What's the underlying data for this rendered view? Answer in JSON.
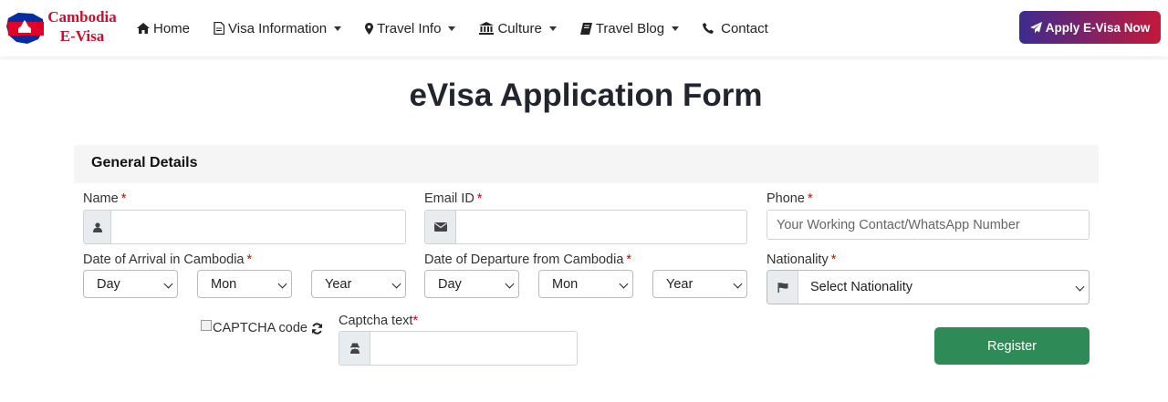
{
  "brand": {
    "line1": "Cambodia",
    "line2": "E-Visa"
  },
  "nav": {
    "items": [
      {
        "label": "Home",
        "icon": "home-icon",
        "dropdown": false
      },
      {
        "label": "Visa Information",
        "icon": "document-icon",
        "dropdown": true
      },
      {
        "label": "Travel Info",
        "icon": "map-marker-icon",
        "dropdown": true
      },
      {
        "label": "Culture",
        "icon": "bank-icon",
        "dropdown": true
      },
      {
        "label": "Travel Blog",
        "icon": "book-icon",
        "dropdown": true
      },
      {
        "label": "Contact",
        "icon": "phone-icon",
        "dropdown": false
      }
    ],
    "apply_label": "Apply E-Visa Now"
  },
  "page": {
    "title": "eVisa Application Form"
  },
  "form": {
    "section_title": "General Details",
    "required_mark": "*",
    "name_label": "Name",
    "name_value": "",
    "email_label": "Email ID",
    "email_value": "",
    "phone_label": "Phone",
    "phone_placeholder": "Your Working Contact/WhatsApp Number",
    "arrival_label": "Date of Arrival in Cambodia",
    "departure_label": "Date of Departure from Cambodia",
    "date_selects": {
      "day": "Day",
      "month": "Mon",
      "year": "Year"
    },
    "nationality_label": "Nationality",
    "nationality_value": "Select Nationality",
    "captcha_alt": "CAPTCHA code",
    "captcha_label": "Captcha text",
    "captcha_value": "",
    "register_label": "Register"
  },
  "colors": {
    "apply_gradient_start": "#3d2b8f",
    "apply_gradient_end": "#c3193a",
    "register_green": "#2e8b57",
    "required_red": "#dd0000",
    "brand_red": "#c8102e"
  }
}
